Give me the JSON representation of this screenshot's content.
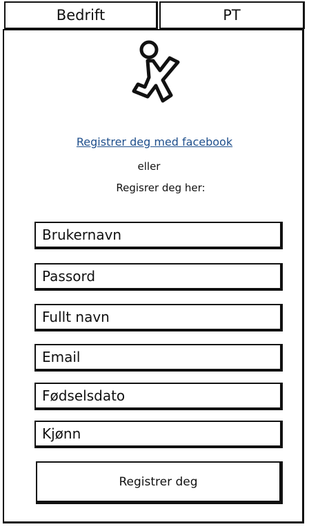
{
  "tabs": [
    {
      "label": "Bedrift"
    },
    {
      "label": "PT"
    }
  ],
  "logo_icon": "running-stick-figure-icon",
  "facebook_link": "Registrer deg med facebook",
  "or_text": "eller",
  "register_here_text": "Regisrer deg her:",
  "fields": [
    {
      "placeholder": "Brukernavn"
    },
    {
      "placeholder": "Passord"
    },
    {
      "placeholder": "Fullt navn"
    },
    {
      "placeholder": "Email"
    },
    {
      "placeholder": "Fødselsdato"
    },
    {
      "placeholder": "Kjønn"
    }
  ],
  "submit_label": "Registrer deg",
  "colors": {
    "link": "#1f4f8c",
    "ink": "#111111",
    "background": "#ffffff"
  }
}
